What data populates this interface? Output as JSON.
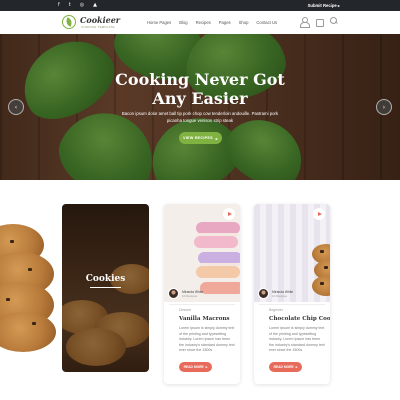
{
  "topbar": {
    "socials": [
      "f",
      "t",
      "◎",
      "▲"
    ],
    "submit_label": "Submit Recipe ▸"
  },
  "header": {
    "brand": "Cookieer",
    "tagline": "COOKING TEMPLATE",
    "nav": [
      "Home Pages",
      "Blog",
      "Recipes",
      "Pages",
      "Shop",
      "Contact Us"
    ],
    "icons": [
      "user-icon",
      "shopping-bag-icon",
      "search-icon"
    ]
  },
  "hero": {
    "title": "Cooking Never Got Any Easier",
    "subtitle": "Bacon ipsum dolor amet ball tip pork chop cow tenderloin andouille. Pastrami pork picanha tongue venison strip steak",
    "button_label": "VIEW RECIPES",
    "button_arrow": "▸",
    "prev_arrow": "‹",
    "next_arrow": "›"
  },
  "section": {
    "feature": {
      "title": "Cookies"
    },
    "cards": [
      {
        "category": "Dessert",
        "title": "Vanilla Macrons",
        "author_name": "Miranda White",
        "author_count": "10 Recipes",
        "text": "Lorem Ipsum is simply dummy text of the printing and typesetting industry. Lorem Ipsum has been the industry's standard dummy text ever since the 1500s",
        "button_label": "READ MORE",
        "button_arrow": "▸"
      },
      {
        "category": "Beginner",
        "title": "Chocolate Chip Cookies",
        "author_name": "Miranda White",
        "author_count": "10 Recipes",
        "text": "Lorem Ipsum is simply dummy text of the printing and typesetting industry. Lorem Ipsum has been the industry's standard dummy text ever since the 1500s",
        "button_label": "READ MORE",
        "button_arrow": "▸"
      }
    ]
  },
  "colors": {
    "accent_green": "#7fb241",
    "accent_coral": "#e86a5a",
    "topbar": "#23262b"
  }
}
